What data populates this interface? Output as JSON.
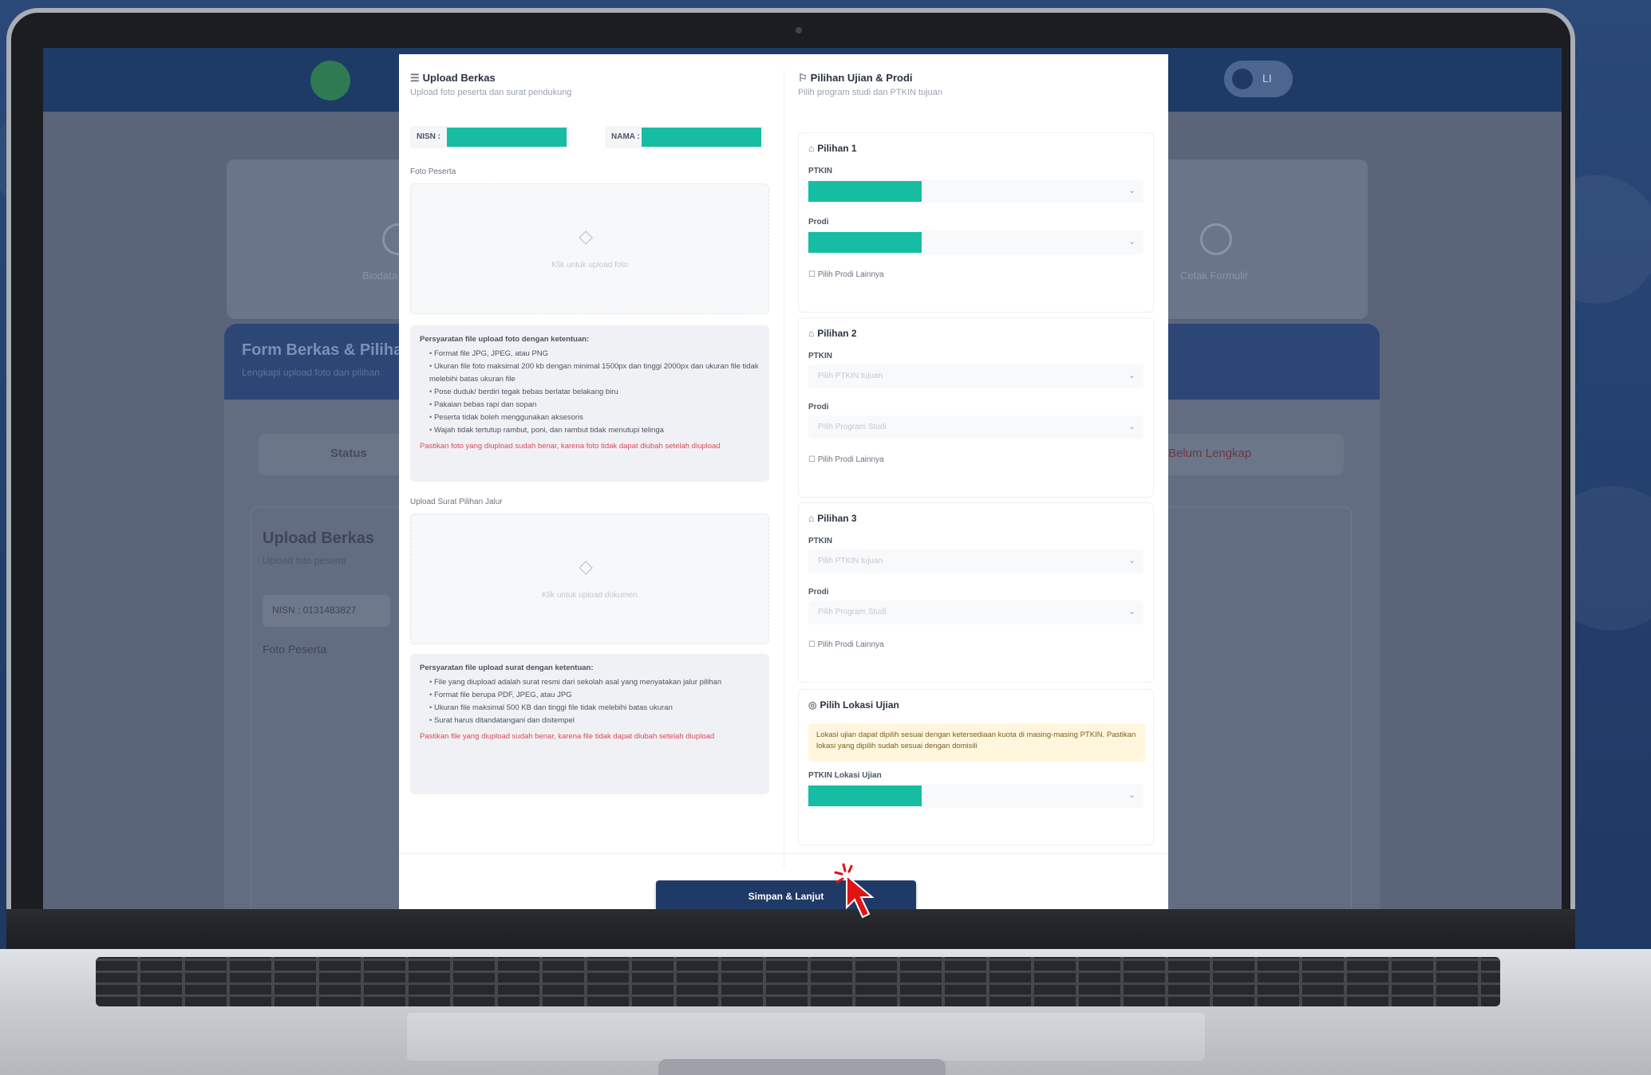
{
  "background_page": {
    "user_badge": "LI",
    "steps": [
      {
        "label": "Biodata"
      },
      {
        "label": "Cetak Formulir"
      }
    ],
    "form_title": "Form Berkas & Pilihan",
    "form_subtitle": "Lengkapi upload foto dan pilihan",
    "status_left": "Status",
    "status_right": "Belum Lengkap",
    "upload_title": "Upload Berkas",
    "upload_subtitle": "Upload foto peserta",
    "nisn_text": "NISN : 0131483827",
    "foto_label": "Foto Peserta"
  },
  "modal": {
    "left": {
      "title": "Upload Berkas",
      "subtitle": "Upload foto peserta dan surat pendukung",
      "id_fields": [
        {
          "label": "NISN :"
        },
        {
          "label": "NAMA :"
        }
      ],
      "foto_label": "Foto Peserta",
      "dropzone1_text": "Klik untuk upload foto",
      "notes1": {
        "head": "Persyaratan file upload foto dengan ketentuan:",
        "items": [
          "Format file JPG, JPEG, atau PNG",
          "Ukuran file foto maksimal 200 kb dengan minimal 1500px dan tinggi 2000px dan ukuran file tidak melebihi batas ukuran file",
          "Pose duduk/ berdiri tegak bebas berlatar belakang biru",
          "Pakaian bebas rapi dan sopan",
          "Peserta tidak boleh menggunakan aksesoris",
          "Wajah tidak tertutup rambut, poni, dan rambut tidak menutupi telinga"
        ],
        "warning": "Pastikan foto yang diupload sudah benar, karena foto tidak dapat diubah setelah diupload"
      },
      "surat_label": "Upload Surat Pilihan Jalur",
      "dropzone2_text": "Klik untuk upload dokumen",
      "notes2": {
        "head": "Persyaratan file upload surat dengan ketentuan:",
        "items": [
          "File yang diupload adalah surat resmi dari sekolah asal yang menyatakan jalur pilihan",
          "Format file berupa PDF, JPEG, atau JPG",
          "Ukuran file maksimal 500 KB dan tinggi file tidak melebihi batas ukuran",
          "Surat harus ditandatangani dan distempel"
        ],
        "warning": "Pastikan file yang diupload sudah benar, karena file tidak dapat diubah setelah diupload"
      }
    },
    "right": {
      "title": "Pilihan Ujian & Prodi",
      "subtitle": "Pilih program studi dan PTKIN tujuan",
      "pilihan": [
        {
          "title": "Pilihan 1",
          "ptkin_label": "PTKIN",
          "prodi_label": "Prodi",
          "ptkin_placeholder": "",
          "prodi_placeholder": "",
          "check_text": "Pilih Prodi Lainnya"
        },
        {
          "title": "Pilihan 2",
          "ptkin_label": "PTKIN",
          "prodi_label": "Prodi",
          "ptkin_placeholder": "Pilih PTKIN tujuan",
          "prodi_placeholder": "Pilih Program Studi",
          "check_text": "Pilih Prodi Lainnya"
        },
        {
          "title": "Pilihan 3",
          "ptkin_label": "PTKIN",
          "prodi_label": "Prodi",
          "ptkin_placeholder": "Pilih PTKIN tujuan",
          "prodi_placeholder": "Pilih Program Studi",
          "check_text": "Pilih Prodi Lainnya"
        }
      ],
      "lokasi": {
        "title": "Pilih Lokasi Ujian",
        "alert": "Lokasi ujian dapat dipilih sesuai dengan ketersediaan kuota di masing-masing PTKIN. Pastikan lokasi yang dipilih sudah sesuai dengan domisili",
        "label": "PTKIN Lokasi Ujian"
      }
    },
    "submit_label": "Simpan & Lanjut"
  },
  "colors": {
    "accent": "#1f3a66",
    "redacted": "#17bda3",
    "warning": "#dc4a5a"
  }
}
